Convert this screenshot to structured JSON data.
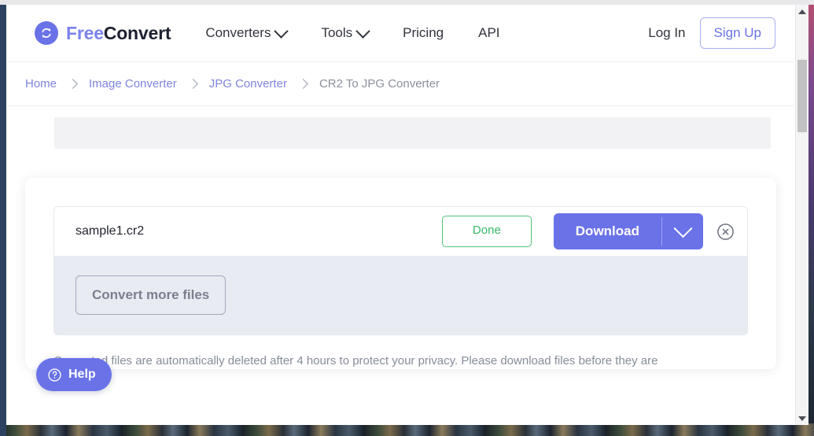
{
  "header": {
    "logo": {
      "icon": "refresh-circle-icon",
      "text_primary": "Free",
      "text_secondary": "Convert"
    },
    "nav": [
      {
        "label": "Converters",
        "has_dropdown": true
      },
      {
        "label": "Tools",
        "has_dropdown": true
      },
      {
        "label": "Pricing",
        "has_dropdown": false
      },
      {
        "label": "API",
        "has_dropdown": false
      }
    ],
    "login_label": "Log In",
    "signup_label": "Sign Up"
  },
  "breadcrumb": {
    "items": [
      {
        "label": "Home",
        "current": false
      },
      {
        "label": "Image Converter",
        "current": false
      },
      {
        "label": "JPG Converter",
        "current": false
      },
      {
        "label": "CR2 To JPG Converter",
        "current": true
      }
    ]
  },
  "main": {
    "file_row": {
      "file_name": "sample1.cr2",
      "status_label": "Done",
      "download_label": "Download",
      "download_caret_icon": "chevron-down-icon",
      "close_icon": "close-circle-icon"
    },
    "convert_more_label": "Convert more files",
    "notice_text": "Converted files are automatically deleted after 4 hours to protect your privacy. Please download files before they are"
  },
  "help_widget": {
    "icon": "question-circle-icon",
    "label": "Help"
  },
  "scrollbar": {
    "up_arrow_icon": "triangle-up-icon",
    "down_arrow_icon": "triangle-down-icon"
  },
  "colors": {
    "brand_purple": "#6a72e8",
    "brand_purple_light": "#7b83ee",
    "success_green": "#36b864",
    "text_dark": "#22252e",
    "text_muted": "#868c99",
    "panel_gray": "#e9ebf3"
  }
}
